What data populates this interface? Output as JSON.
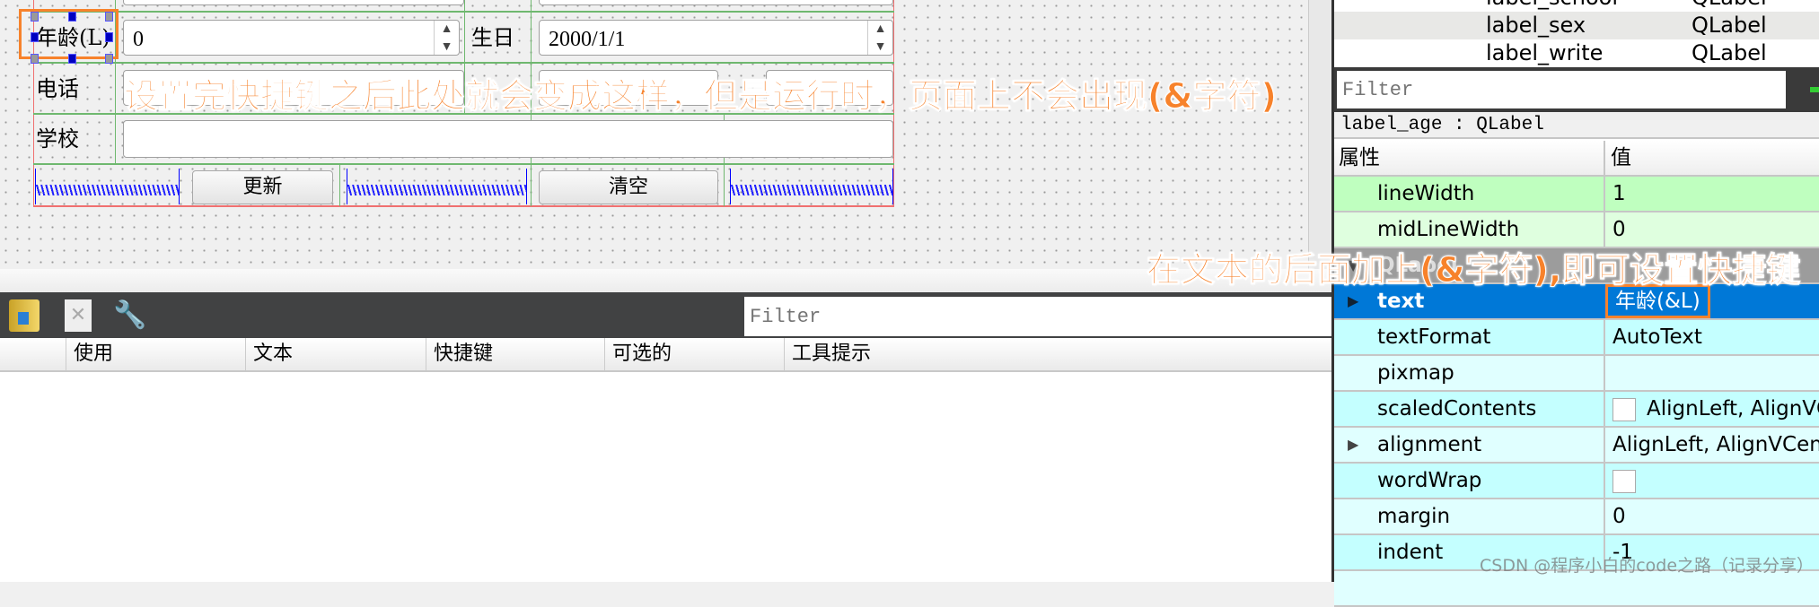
{
  "form": {
    "age_label": "年龄(L)",
    "age_value": "0",
    "birthday_label": "生日",
    "birthday_value": "2000/1/1",
    "phone_label": "电话",
    "school_label": "学校",
    "update_button": "更新",
    "clear_button": "清空"
  },
  "annotations": {
    "form_note": "设置完快捷键之后此处就会变成这样，但是运行时，页面上不会出现(&字符)",
    "property_note": "在文本的后面加上(&字符),即可设置快捷键"
  },
  "action_editor": {
    "filter_placeholder": "Filter",
    "columns": [
      "",
      "使用",
      "文本",
      "快捷键",
      "可选的",
      "工具提示"
    ]
  },
  "object_inspector": {
    "rows": [
      {
        "name": "label_school",
        "class": "QLabel"
      },
      {
        "name": "label_sex",
        "class": "QLabel"
      },
      {
        "name": "label_write",
        "class": "QLabel"
      }
    ]
  },
  "property_editor": {
    "filter_placeholder": "Filter",
    "object_label": "label_age : QLabel",
    "header_property": "属性",
    "header_value": "值",
    "group": "QLabel",
    "rows": [
      {
        "name": "lineWidth",
        "value": "1"
      },
      {
        "name": "midLineWidth",
        "value": "0"
      },
      {
        "name": "text",
        "value": "年龄(&L)"
      },
      {
        "name": "textFormat",
        "value": "AutoText"
      },
      {
        "name": "pixmap",
        "value": ""
      },
      {
        "name": "scaledContents",
        "value": "AlignLeft, AlignVCenter"
      },
      {
        "name": "alignment",
        "value": "AlignLeft, AlignVCenter"
      },
      {
        "name": "wordWrap",
        "value": ""
      },
      {
        "name": "margin",
        "value": "0"
      },
      {
        "name": "indent",
        "value": "-1"
      }
    ],
    "colors": {
      "selected": "#0078d7",
      "frame_green": "#bfffbf",
      "frame_green_light": "#dfffdf",
      "label_cyan": "#c4ffff",
      "accent": "#f7822b"
    }
  },
  "watermark": "CSDN @程序小白的code之路（记录分享）"
}
